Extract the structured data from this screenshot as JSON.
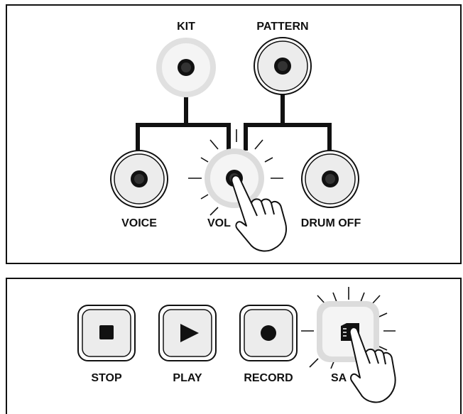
{
  "top_panel": {
    "labels": {
      "kit": "KIT",
      "pattern": "PATTERN",
      "voice": "VOICE",
      "volume": "VOL",
      "drum_off": "DRUM OFF"
    }
  },
  "bottom_panel": {
    "labels": {
      "stop": "STOP",
      "play": "PLAY",
      "record": "RECORD",
      "save": "SA"
    }
  },
  "icons": {
    "stop": "stop-square-icon",
    "play": "play-triangle-icon",
    "record": "record-dot-icon",
    "save": "save-card-icon",
    "hand": "pointing-hand-icon",
    "highlight": "press-glow-icon"
  },
  "colors": {
    "ink": "#111111",
    "button_face": "#ececec",
    "glow": "#dcdcdc"
  }
}
